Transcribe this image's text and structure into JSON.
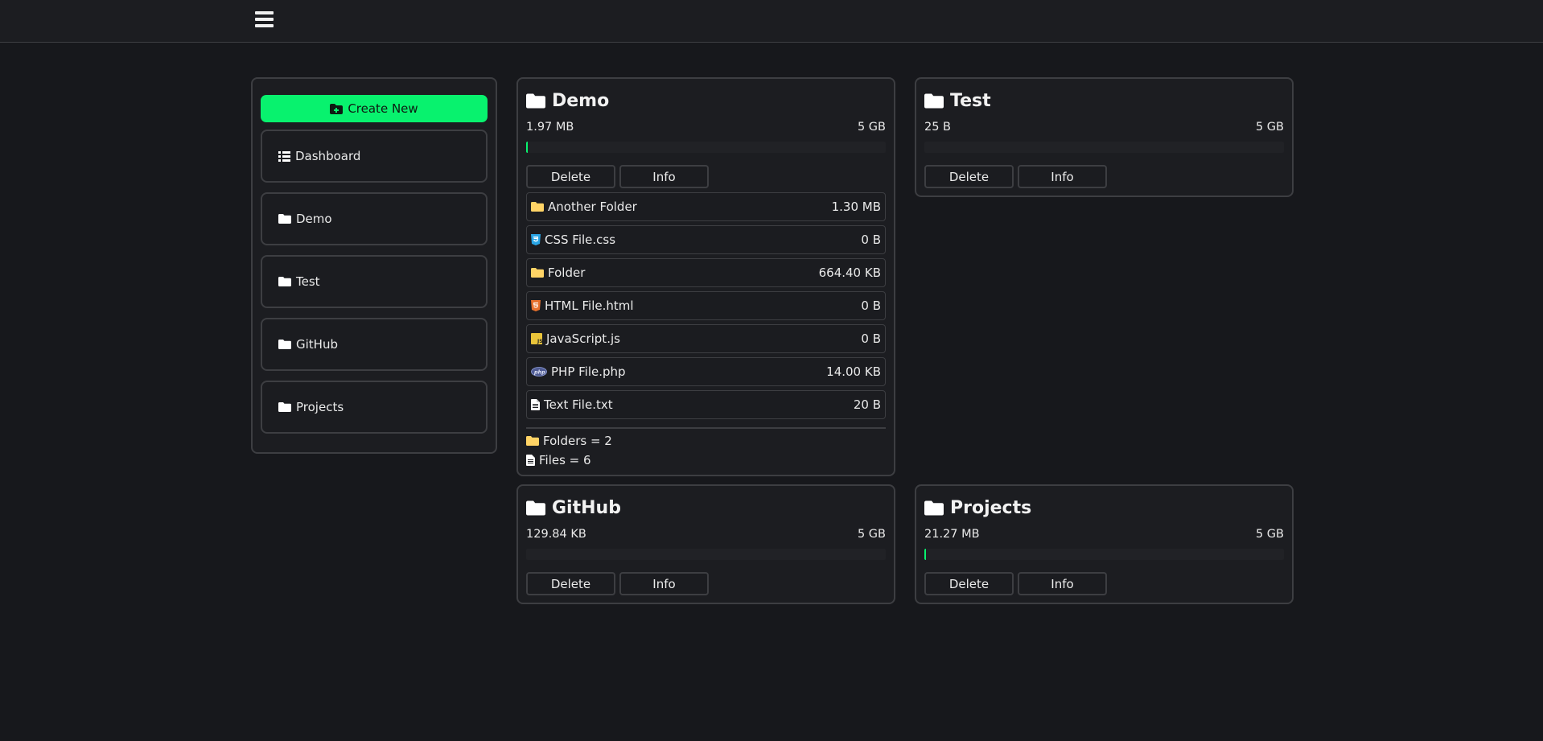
{
  "sidebar": {
    "create_label": "Create New",
    "items": [
      {
        "label": "Dashboard",
        "icon": "list-icon"
      },
      {
        "label": "Demo",
        "icon": "folder-icon"
      },
      {
        "label": "Test",
        "icon": "folder-icon"
      },
      {
        "label": "GitHub",
        "icon": "folder-icon"
      },
      {
        "label": "Projects",
        "icon": "folder-icon"
      }
    ]
  },
  "buttons": {
    "delete": "Delete",
    "info": "Info"
  },
  "cards": {
    "demo": {
      "title": "Demo",
      "used": "1.97 MB",
      "quota": "5 GB",
      "usage_fraction": 0.0004,
      "files": [
        {
          "name": "Another Folder",
          "size": "1.30 MB",
          "icon": "folder-icon"
        },
        {
          "name": "CSS File.css",
          "size": "0 B",
          "icon": "css-file-icon"
        },
        {
          "name": "Folder",
          "size": "664.40 KB",
          "icon": "folder-icon"
        },
        {
          "name": "HTML File.html",
          "size": "0 B",
          "icon": "html-file-icon"
        },
        {
          "name": "JavaScript.js",
          "size": "0 B",
          "icon": "js-file-icon"
        },
        {
          "name": "PHP File.php",
          "size": "14.00 KB",
          "icon": "php-file-icon"
        },
        {
          "name": "Text File.txt",
          "size": "20 B",
          "icon": "text-file-icon"
        }
      ],
      "folders_summary": "Folders = 2",
      "files_summary": "Files = 6"
    },
    "test": {
      "title": "Test",
      "used": "25 B",
      "quota": "5 GB",
      "usage_fraction": 0.0
    },
    "github": {
      "title": "GitHub",
      "used": "129.84 KB",
      "quota": "5 GB",
      "usage_fraction": 0.0
    },
    "projects": {
      "title": "Projects",
      "used": "21.27 MB",
      "quota": "5 GB",
      "usage_fraction": 0.004
    }
  },
  "colors": {
    "accent": "#08f26e",
    "folder": "#ffd466",
    "css": "#2aa6e6",
    "html": "#e8702c",
    "js": "#e9c43a"
  }
}
